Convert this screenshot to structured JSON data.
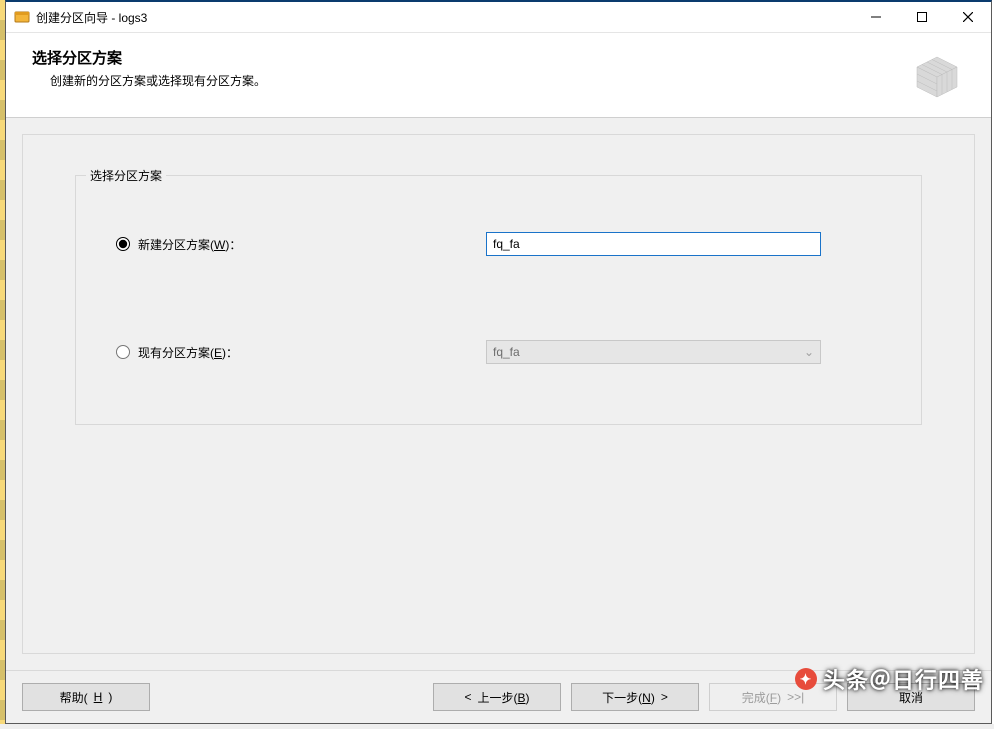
{
  "titlebar": {
    "title": "创建分区向导 - logs3"
  },
  "header": {
    "title": "选择分区方案",
    "description": "创建新的分区方案或选择现有分区方案。"
  },
  "fieldset": {
    "legend": "选择分区方案",
    "options": {
      "new": {
        "label_pre": "新建分区方案(",
        "mnemonic": "W",
        "label_post": ")："
      },
      "existing": {
        "label_pre": "现有分区方案(",
        "mnemonic": "E",
        "label_post": ")："
      }
    },
    "new_value": "fq_fa",
    "existing_value": "fq_fa"
  },
  "buttons": {
    "help_pre": "帮助(",
    "help_m": "H",
    "help_post": ")",
    "back_pre": "上一步(",
    "back_m": "B",
    "back_post": ")",
    "next_pre": "下一步(",
    "next_m": "N",
    "next_post": ")",
    "finish_pre": "完成(",
    "finish_m": "F",
    "finish_post": ")",
    "cancel": "取消"
  },
  "watermark": "头条＠日行四善",
  "glyphs": {
    "back_arrow": "<",
    "next_arrow": ">",
    "finish_arrow": ">>|",
    "chevron_down": "⌄"
  }
}
